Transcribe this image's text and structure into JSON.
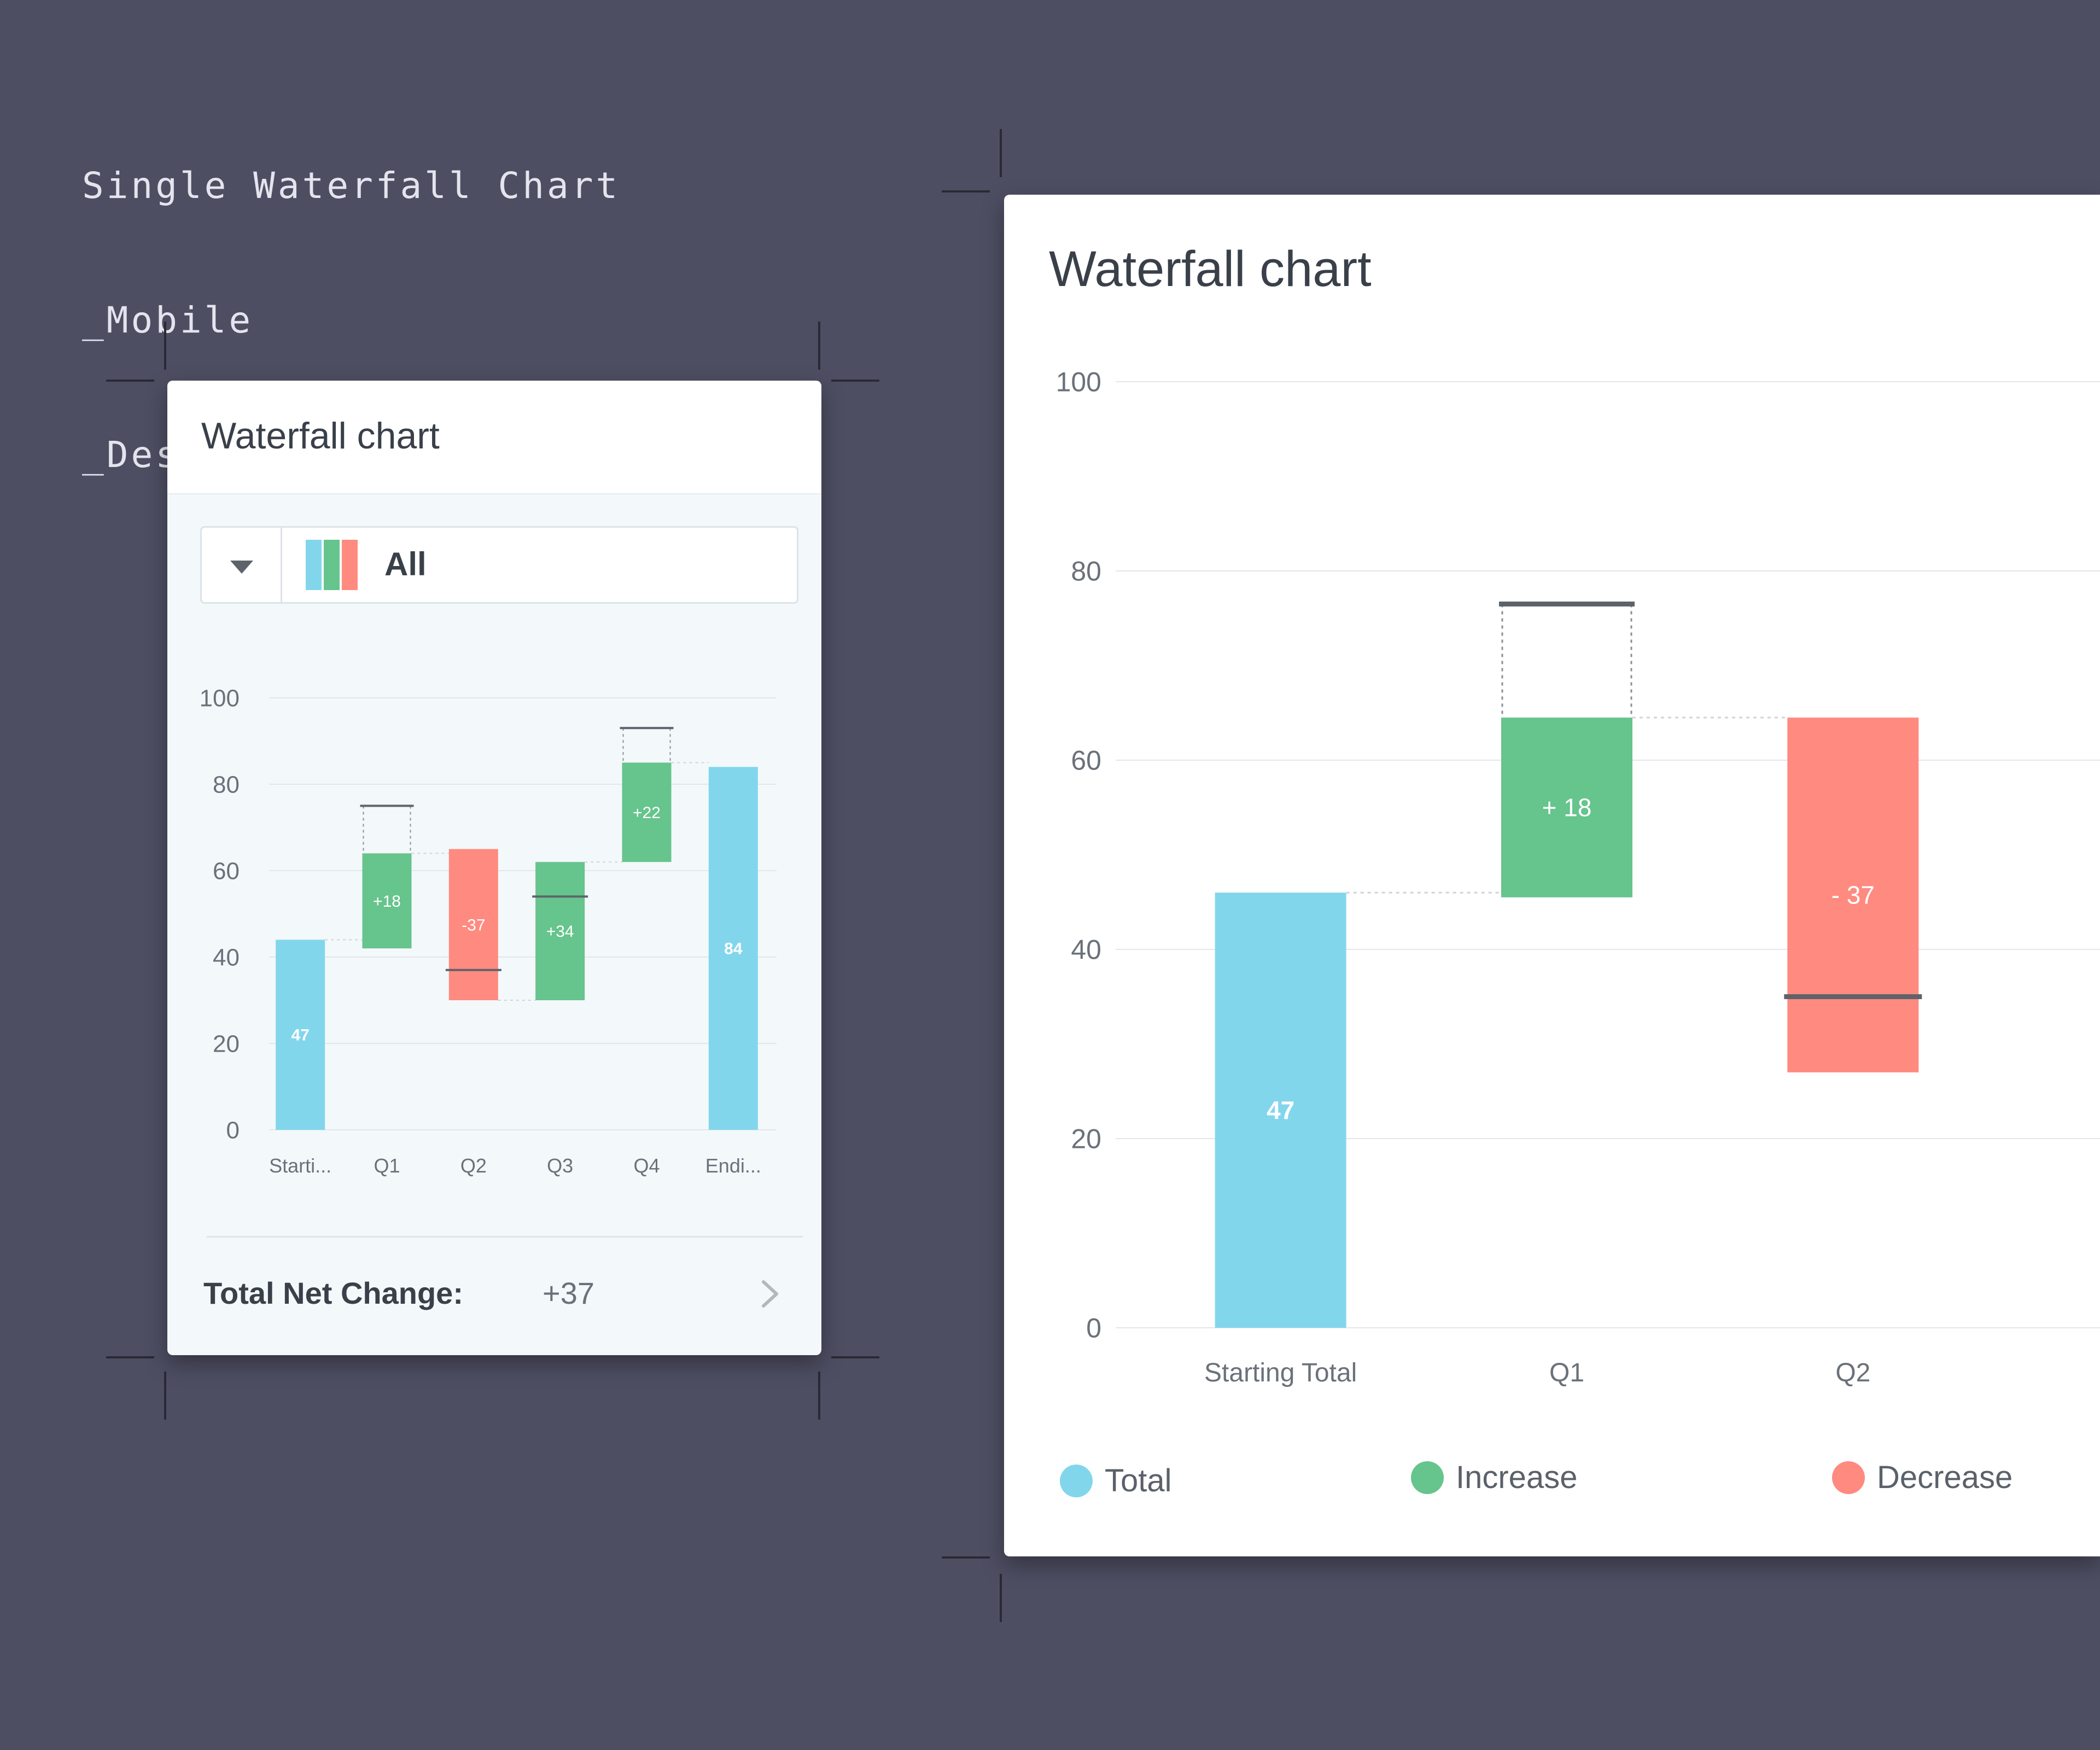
{
  "caption": {
    "lines": [
      "Single Waterfall Chart",
      "_Mobile",
      "_Desktop"
    ]
  },
  "colors": {
    "total": "#82d6ec",
    "increase": "#66c48d",
    "decrease": "#ff8a80",
    "background": "#4e4e63"
  },
  "mobile": {
    "title": "Waterfall chart",
    "filter": {
      "selected": "All",
      "icon": "caret-down-icon"
    },
    "footer": {
      "label": "Total Net Change:",
      "value": "+37",
      "icon": "chevron-right-icon"
    }
  },
  "desktop": {
    "title": "Waterfall chart",
    "legend": [
      {
        "label": "Total",
        "kind": "total"
      },
      {
        "label": "Increase",
        "kind": "increase"
      },
      {
        "label": "Decrease",
        "kind": "decrease"
      }
    ]
  },
  "chart_data": [
    {
      "type": "bar",
      "subtype": "waterfall",
      "view": "mobile",
      "title": "Waterfall chart",
      "categories": [
        "Starti...",
        "Q1",
        "Q2",
        "Q3",
        "Q4",
        "Endi..."
      ],
      "bars": [
        {
          "category": "Starti...",
          "kind": "total",
          "start": 0,
          "end": 44,
          "label": "47"
        },
        {
          "category": "Q1",
          "kind": "increase",
          "start": 42,
          "end": 64,
          "label": "+18",
          "ghost_top": 75
        },
        {
          "category": "Q2",
          "kind": "decrease",
          "start": 30,
          "end": 65,
          "label": "-37",
          "marker": 37
        },
        {
          "category": "Q3",
          "kind": "increase",
          "start": 30,
          "end": 62,
          "label": "+34",
          "marker": 54
        },
        {
          "category": "Q4",
          "kind": "increase",
          "start": 62,
          "end": 85,
          "label": "+22",
          "ghost_top": 93
        },
        {
          "category": "Endi...",
          "kind": "total",
          "start": 0,
          "end": 84,
          "label": "84"
        }
      ],
      "yticks": [
        0,
        20,
        40,
        60,
        80,
        100
      ],
      "ylim": [
        0,
        100
      ],
      "grid": true
    },
    {
      "type": "bar",
      "subtype": "waterfall",
      "view": "desktop",
      "title": "Waterfall chart",
      "categories": [
        "Starting Total",
        "Q1",
        "Q2"
      ],
      "bars": [
        {
          "category": "Starting Total",
          "kind": "total",
          "start": 0,
          "end": 46,
          "label": "47"
        },
        {
          "category": "Q1",
          "kind": "increase",
          "start": 45.5,
          "end": 64.5,
          "label": "+ 18",
          "ghost_top": 76.5
        },
        {
          "category": "Q2",
          "kind": "decrease",
          "start": 27,
          "end": 64.5,
          "label": "- 37",
          "marker": 35
        }
      ],
      "yticks": [
        0,
        20,
        40,
        60,
        80,
        100
      ],
      "ylim": [
        0,
        100
      ],
      "grid": true,
      "legend": [
        "Total",
        "Increase",
        "Decrease"
      ],
      "legend_position": "bottom"
    }
  ]
}
